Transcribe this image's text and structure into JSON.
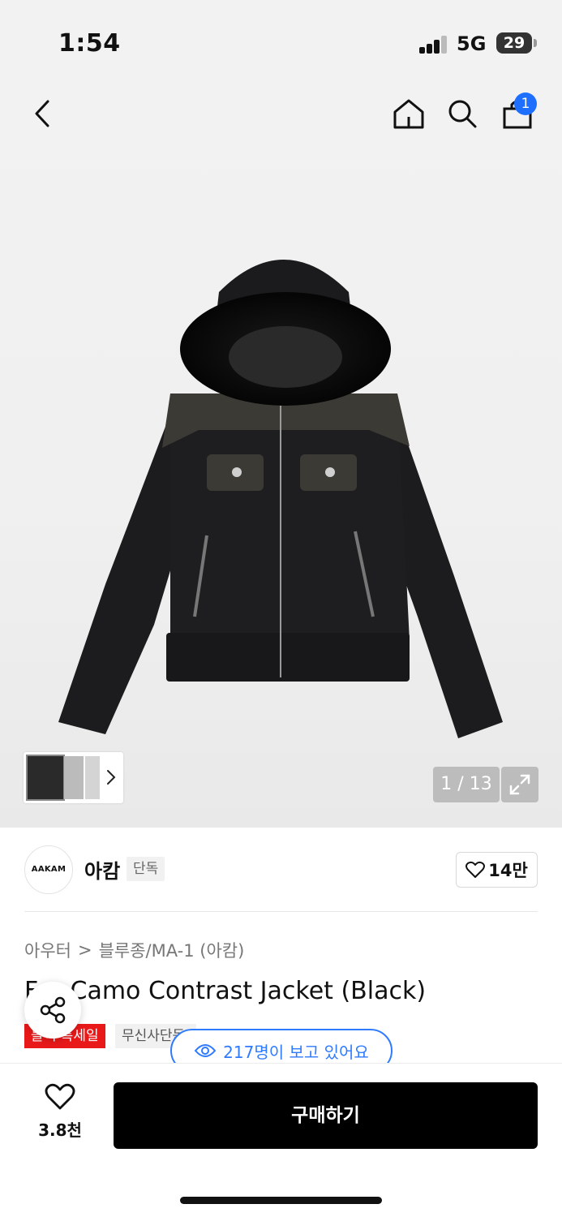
{
  "status_bar": {
    "time": "1:54",
    "network": "5G",
    "battery": "29"
  },
  "nav": {
    "cart_count": "1"
  },
  "gallery": {
    "counter": "1 / 13"
  },
  "brand": {
    "logo_text": "AAKAM",
    "name": "아캄",
    "tag": "단독",
    "likes": "14만"
  },
  "breadcrumb": {
    "category": "아우터",
    "separator": ">",
    "subcategory": "블루종/MA-1 (아캄)"
  },
  "product": {
    "title": "Fur Camo Contrast Jacket (Black)"
  },
  "tags": {
    "sale": "블랙 특세일",
    "exclusive": "무신사단독"
  },
  "viewers": {
    "text": "217명이 보고 있어요"
  },
  "bottom_bar": {
    "wish_count": "3.8천",
    "buy_label": "구매하기"
  },
  "colors": {
    "accent_blue": "#2f7bff",
    "sale_red": "#e9191a",
    "buy_black": "#000000",
    "badge_blue": "#1f6fff"
  }
}
